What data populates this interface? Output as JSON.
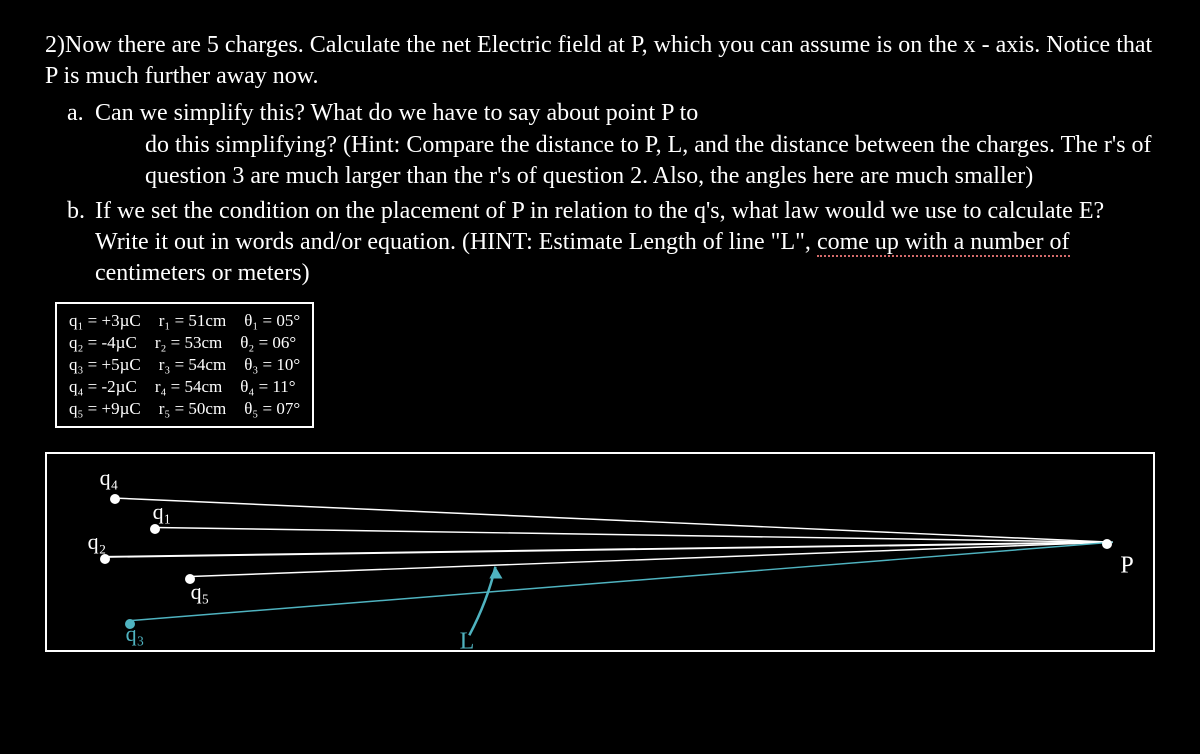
{
  "problem": {
    "number": "2)",
    "intro": "Now there are 5 charges. Calculate the net Electric field at P, which you can assume is on the x - axis. Notice that P is much further away now.",
    "a_marker": "a.",
    "a_line1": "Can we simplify this? What do we have to say about point P to",
    "a_line2": "do this simplifying? (Hint: Compare the distance to P, L, and the distance between the charges. The r's of question 3 are much larger than the r's of question 2. Also, the angles here are much smaller)",
    "b_marker": "b.",
    "b_line1": "If we set the condition on the placement of P in relation to the q's, what law would we use to calculate E? Write it out in words and/or equation. (HINT: Estimate Length of line \"L\", ",
    "b_line2_underlined": "come up with a number of",
    "b_line2_after": " centimeters or meters)"
  },
  "data": {
    "rows": [
      {
        "q": "q₁ = +3µC",
        "r": "r₁ = 51cm",
        "t": "θ₁ = 05°"
      },
      {
        "q": "q₂ = -4µC",
        "r": "r₂ = 53cm",
        "t": "θ₂ = 06°"
      },
      {
        "q": "q₃ = +5µC",
        "r": "r₃ = 54cm",
        "t": "θ₃ = 10°"
      },
      {
        "q": "q₄ = -2µC",
        "r": "r₄ = 54cm",
        "t": "θ₄ = 11°"
      },
      {
        "q": "q₅ = +9µC",
        "r": "r₅ = 50cm",
        "t": "θ₅ = 07°"
      }
    ]
  },
  "diagram": {
    "labels": {
      "q1": "q₁",
      "q2": "q₂",
      "q3": "q₃",
      "q4": "q₄",
      "q5": "q₅",
      "P": "P",
      "L": "L"
    }
  }
}
